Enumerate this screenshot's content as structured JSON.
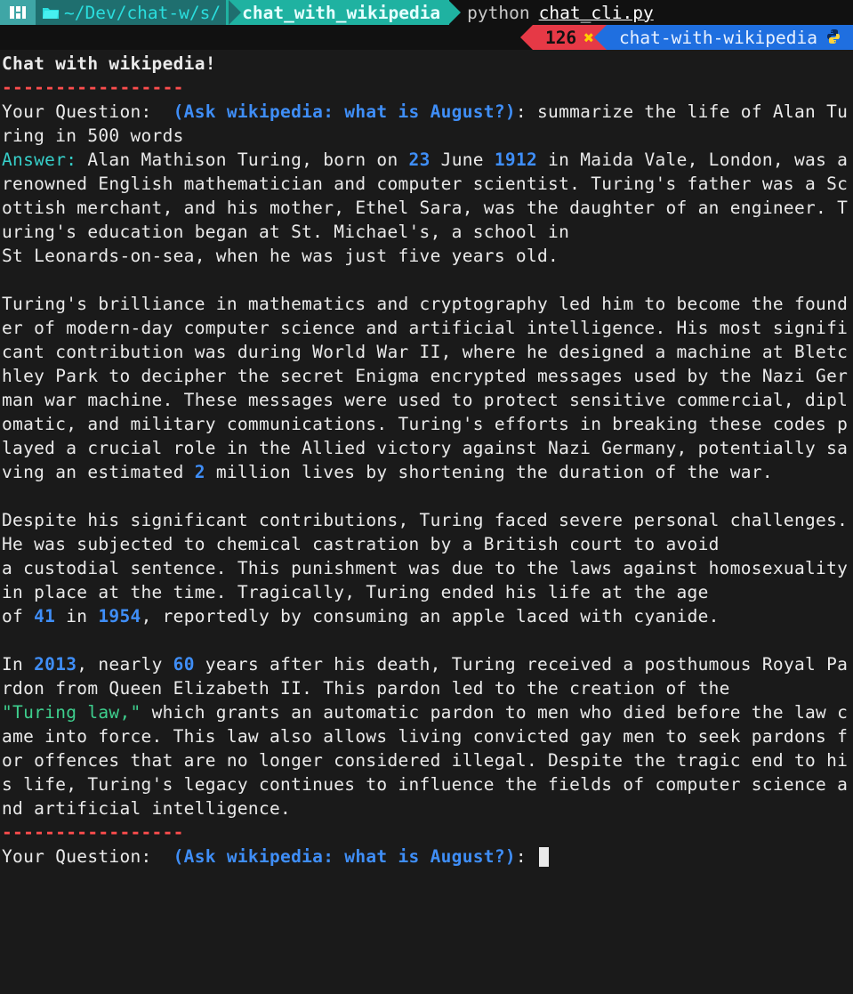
{
  "topbar": {
    "path_prefix": "~/Dev/chat-w/s/",
    "path_highlight": "chat_with_wikipedia",
    "command_interpreter": "python",
    "command_file": "chat_cli.py"
  },
  "tabs": {
    "count": "126",
    "label": "chat-with-wikipedia"
  },
  "cli": {
    "title": "Chat with wikipedia!",
    "divider": "-----------------",
    "question_label": "Your Question:  ",
    "question_hint": "(Ask wikipedia: what is August?)",
    "question_colon": ": ",
    "user_question": "summarize the life of Alan Turing in 500 words",
    "answer_label": "Answer:",
    "answer_segments": [
      {
        "t": " Alan Mathison Turing, born on "
      },
      {
        "t": "23",
        "c": "bblue"
      },
      {
        "t": " June "
      },
      {
        "t": "1912",
        "c": "bblue"
      },
      {
        "t": " in Maida Vale, London, was a renowned English mathematician and computer scientist. Turing's father was a Scottish merchant, and his mother, Ethel Sara, was the daughter of an engineer. Turing's education began at St. Michael's, a school in\nSt Leonards-on-sea, when he was just five years old.\n\nTuring's brilliance in mathematics and cryptography led him to become the founder of modern-day computer science and artificial intelligence. His most significant contribution was during World War II, where he designed a machine at Bletchley Park to decipher the secret Enigma encrypted messages used by the Nazi German war machine. These messages were used to protect sensitive commercial, diplomatic, and military communications. Turing's efforts in breaking these codes played a crucial role in the Allied victory against Nazi Germany, potentially saving an estimated "
      },
      {
        "t": "2",
        "c": "bblue"
      },
      {
        "t": " million lives by shortening the duration of the war.\n\nDespite his significant contributions, Turing faced severe personal challenges. He was subjected to chemical castration by a British court to avoid\na custodial sentence. This punishment was due to the laws against homosexuality in place at the time. Tragically, Turing ended his life at the age\nof "
      },
      {
        "t": "41",
        "c": "bblue"
      },
      {
        "t": " in "
      },
      {
        "t": "1954",
        "c": "bblue"
      },
      {
        "t": ", reportedly by consuming an apple laced with cyanide.\n\nIn "
      },
      {
        "t": "2013",
        "c": "bblue"
      },
      {
        "t": ", nearly "
      },
      {
        "t": "60",
        "c": "bblue"
      },
      {
        "t": " years after his death, Turing received a posthumous Royal Pardon from Queen Elizabeth II. This pardon led to the creation of the\n"
      },
      {
        "t": "\"Turing law,\"",
        "c": "green"
      },
      {
        "t": " which grants an automatic pardon to men who died before the law came into force. This law also allows living convicted gay men to seek pardons for offences that are no longer considered illegal. Despite the tragic end to his life, Turing's legacy continues to influence the fields of computer science and artificial intelligence."
      }
    ]
  },
  "colors": {
    "bg": "#1a1a1a",
    "cyan": "#36cfc9",
    "blue": "#3f8ef7",
    "green": "#3ecf8e",
    "red": "#ff4d4d",
    "tab_red": "#e63946",
    "tab_blue": "#1f6fe0",
    "path_bg": "#1fb2a1"
  }
}
